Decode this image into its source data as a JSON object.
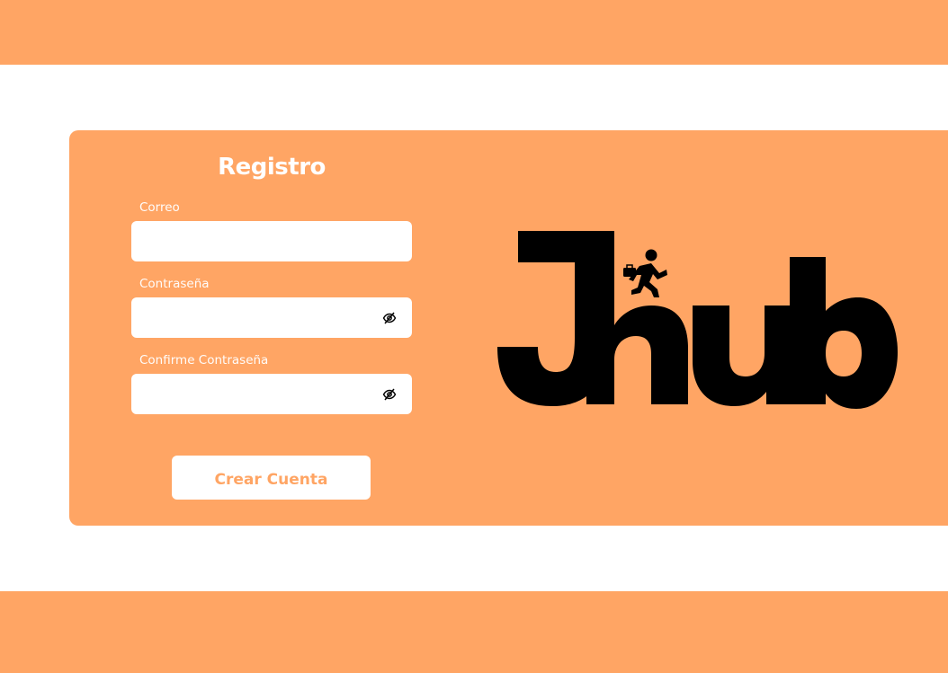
{
  "colors": {
    "accent": "#FFA564",
    "surface": "#FFFFFF",
    "logo": "#000000"
  },
  "form": {
    "title": "Registro",
    "email": {
      "label": "Correo",
      "value": "",
      "placeholder": ""
    },
    "password": {
      "label": "Contraseña",
      "value": "",
      "placeholder": "",
      "toggle_icon": "eye-slash-icon"
    },
    "confirm_password": {
      "label": "Confirme Contraseña",
      "value": "",
      "placeholder": "",
      "toggle_icon": "eye-slash-icon"
    },
    "submit_label": "Crear Cuenta"
  },
  "logo": {
    "text": "Jhub",
    "icon": "running-person-briefcase-icon"
  }
}
